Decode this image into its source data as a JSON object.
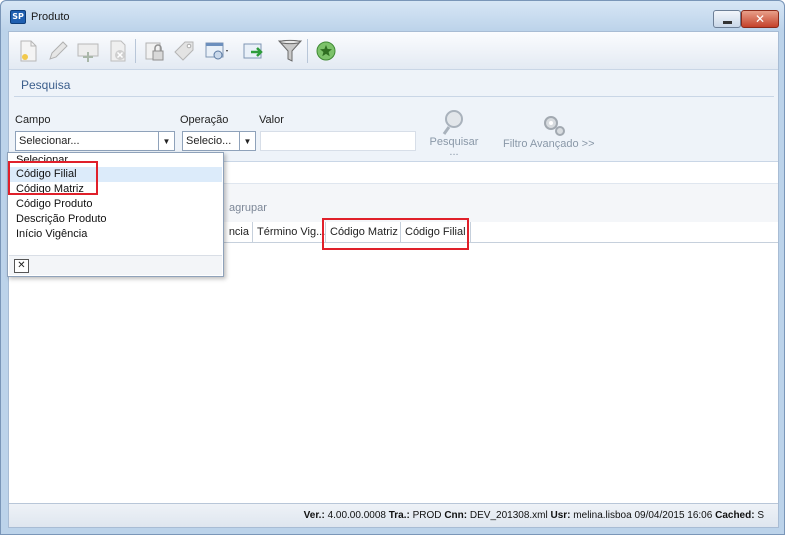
{
  "window": {
    "title": "Produto",
    "app_icon_text": "SP",
    "minimize_symbol": "",
    "close_symbol": "✕"
  },
  "toolbar": {
    "icons": [
      "new-document-icon",
      "edit-icon",
      "add-row-icon",
      "delete-icon",
      "lock-icon",
      "tag-icon",
      "view-options-icon",
      "export-icon",
      "filter-funnel-icon",
      "favorite-star-icon"
    ]
  },
  "search": {
    "panel_title": "Pesquisa",
    "campo_label": "Campo",
    "campo_value": "Selecionar...",
    "operacao_label": "Operação",
    "operacao_value": "Selecio...",
    "valor_label": "Valor",
    "valor_value": "",
    "pesquisar_label": "Pesquisar",
    "pesquisar_ellipsis": "...",
    "filtro_label": "Filtro Avançado >>"
  },
  "dropdown": {
    "items": [
      "Selecionar...",
      "Código Filial",
      "Código Matriz",
      "Código Produto",
      "Descrição Produto",
      "Início Vigência"
    ],
    "close_symbol": "✕"
  },
  "grid": {
    "agrupar_text": "agrupar",
    "columns": [
      "ncia",
      "Término Vig...",
      "Código Matriz",
      "Código Filial"
    ]
  },
  "status": {
    "ver_label": "Ver.:",
    "ver_value": "4.00.00.0008",
    "tra_label": "Tra.:",
    "tra_value": "PROD",
    "cnn_label": "Cnn:",
    "cnn_value": "DEV_201308.xml",
    "usr_label": "Usr:",
    "usr_value": "melina.lisboa",
    "datetime": "09/04/2015 16:06",
    "cached_label": "Cached:",
    "cached_value": "S"
  },
  "colors": {
    "highlight_red": "#e0202a",
    "selection_blue": "#dcebfa",
    "title_blue": "#3b5e8c"
  }
}
